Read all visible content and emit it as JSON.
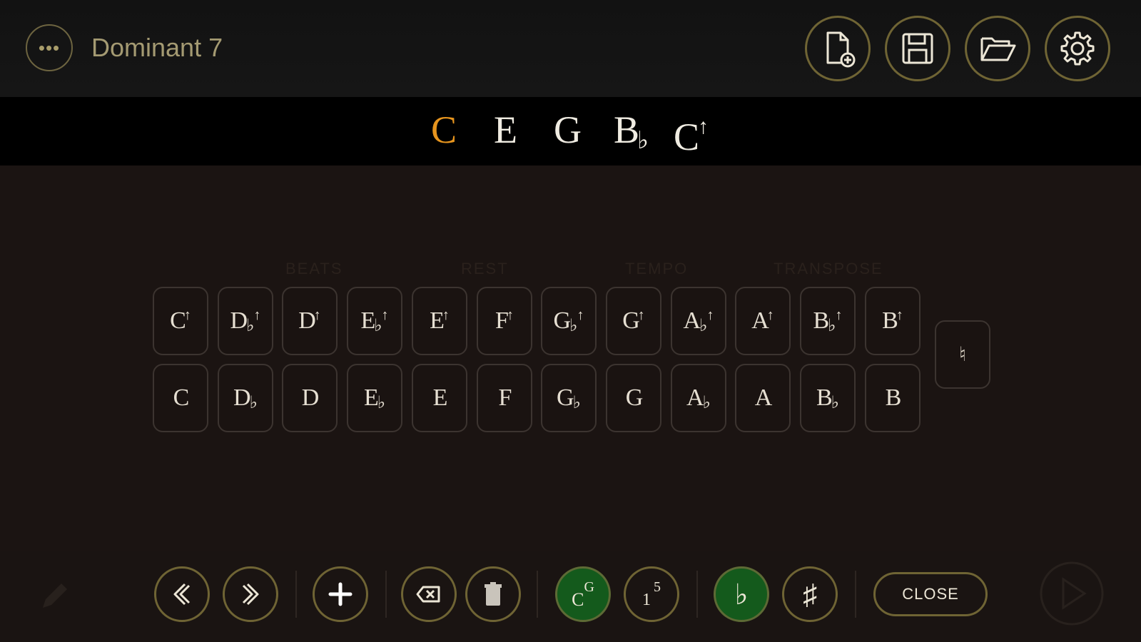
{
  "header": {
    "title": "Dominant 7",
    "menu_icon": "ellipsis-icon",
    "tools": [
      "new-document-icon",
      "save-icon",
      "open-folder-icon",
      "settings-gear-icon"
    ]
  },
  "chord": {
    "notes": [
      {
        "letter": "C",
        "accidental": "",
        "octave_up": "",
        "is_root": true
      },
      {
        "letter": "E",
        "accidental": "",
        "octave_up": "",
        "is_root": false
      },
      {
        "letter": "G",
        "accidental": "",
        "octave_up": "",
        "is_root": false
      },
      {
        "letter": "B",
        "accidental": "♭",
        "octave_up": "",
        "is_root": false
      },
      {
        "letter": "C",
        "accidental": "",
        "octave_up": "↑",
        "is_root": false
      }
    ]
  },
  "keyboard": {
    "upper_row": [
      {
        "letter": "C",
        "acc": "",
        "up": "↑"
      },
      {
        "letter": "D",
        "acc": "♭",
        "up": "↑"
      },
      {
        "letter": "D",
        "acc": "",
        "up": "↑"
      },
      {
        "letter": "E",
        "acc": "♭",
        "up": "↑"
      },
      {
        "letter": "E",
        "acc": "",
        "up": "↑"
      },
      {
        "letter": "F",
        "acc": "",
        "up": "↑"
      },
      {
        "letter": "G",
        "acc": "♭",
        "up": "↑"
      },
      {
        "letter": "G",
        "acc": "",
        "up": "↑"
      },
      {
        "letter": "A",
        "acc": "♭",
        "up": "↑"
      },
      {
        "letter": "A",
        "acc": "",
        "up": "↑"
      },
      {
        "letter": "B",
        "acc": "♭",
        "up": "↑"
      },
      {
        "letter": "B",
        "acc": "",
        "up": "↑"
      }
    ],
    "lower_row": [
      {
        "letter": "C",
        "acc": ""
      },
      {
        "letter": "D",
        "acc": "♭"
      },
      {
        "letter": "D",
        "acc": ""
      },
      {
        "letter": "E",
        "acc": "♭"
      },
      {
        "letter": "E",
        "acc": ""
      },
      {
        "letter": "F",
        "acc": ""
      },
      {
        "letter": "G",
        "acc": "♭"
      },
      {
        "letter": "G",
        "acc": ""
      },
      {
        "letter": "A",
        "acc": "♭"
      },
      {
        "letter": "A",
        "acc": ""
      },
      {
        "letter": "B",
        "acc": "♭"
      },
      {
        "letter": "B",
        "acc": ""
      }
    ],
    "natural_label": "♮"
  },
  "background_labels": [
    "BEATS",
    "REST",
    "TEMPO",
    "TRANSPOSE"
  ],
  "toolbar": {
    "close_label": "CLOSE",
    "note_name_label": "C",
    "note_name_sup": "G",
    "degree_label": "1",
    "degree_sup": "5",
    "flat_label": "♭",
    "sharp_label": "♯",
    "colors": {
      "accent": "#e7951e",
      "active_green": "#145a1c",
      "ring": "#6f6434"
    }
  }
}
